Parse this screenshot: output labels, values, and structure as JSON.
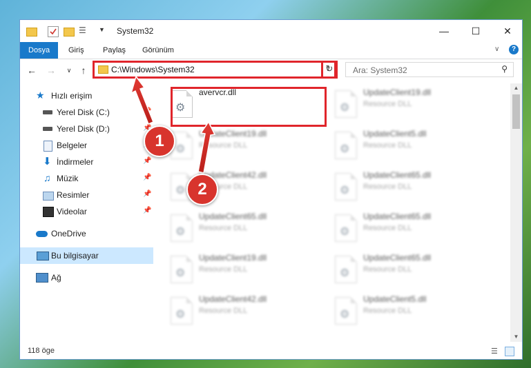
{
  "window": {
    "title": "System32",
    "ribbon_tabs": [
      "Dosya",
      "Giriş",
      "Paylaş",
      "Görünüm"
    ]
  },
  "navigation": {
    "address": "C:\\Windows\\System32",
    "search_placeholder": "Ara: System32"
  },
  "sidebar": {
    "items": [
      {
        "label": "Hızlı erişim",
        "icon": "star-icon",
        "pinned": false
      },
      {
        "label": "Yerel Disk (C:)",
        "icon": "drive-icon",
        "pinned": true
      },
      {
        "label": "Yerel Disk (D:)",
        "icon": "drive-icon",
        "pinned": true
      },
      {
        "label": "Belgeler",
        "icon": "documents-icon",
        "pinned": true
      },
      {
        "label": "İndirmeler",
        "icon": "download-icon",
        "pinned": true
      },
      {
        "label": "Müzik",
        "icon": "music-icon",
        "pinned": true
      },
      {
        "label": "Resimler",
        "icon": "pictures-icon",
        "pinned": true
      },
      {
        "label": "Videolar",
        "icon": "videos-icon",
        "pinned": true
      },
      {
        "label": "OneDrive",
        "icon": "cloud-icon",
        "pinned": false
      },
      {
        "label": "Bu bilgisayar",
        "icon": "computer-icon",
        "pinned": false
      },
      {
        "label": "Ağ",
        "icon": "network-icon",
        "pinned": false
      }
    ]
  },
  "files": {
    "highlighted": {
      "name": "avervcr.dll"
    },
    "left_column": [
      {
        "name": "UpdateClient19.dll",
        "type": "Resource DLL"
      },
      {
        "name": "UpdateClient42.dll",
        "type": "Resource DLL"
      },
      {
        "name": "UpdateClient65.dll",
        "type": "Resource DLL"
      },
      {
        "name": "UpdateClient19.dll",
        "type": "Resource DLL"
      },
      {
        "name": "UpdateClient42.dll",
        "type": "Resource DLL"
      }
    ],
    "right_column": [
      {
        "name": "UpdateClient19.dll",
        "type": "Resource DLL"
      },
      {
        "name": "UpdateClient5.dll",
        "type": "Resource DLL"
      },
      {
        "name": "UpdateClient65.dll",
        "type": "Resource DLL"
      },
      {
        "name": "UpdateClient65.dll",
        "type": "Resource DLL"
      },
      {
        "name": "UpdateClient65.dll",
        "type": "Resource DLL"
      },
      {
        "name": "UpdateClient5.dll",
        "type": "Resource DLL"
      }
    ]
  },
  "status": {
    "count": "118 öge"
  },
  "annotations": {
    "step1": "1",
    "step2": "2",
    "highlight_color": "#e0252b"
  },
  "colors": {
    "accent": "#1979ca",
    "selected": "#cce8ff"
  }
}
